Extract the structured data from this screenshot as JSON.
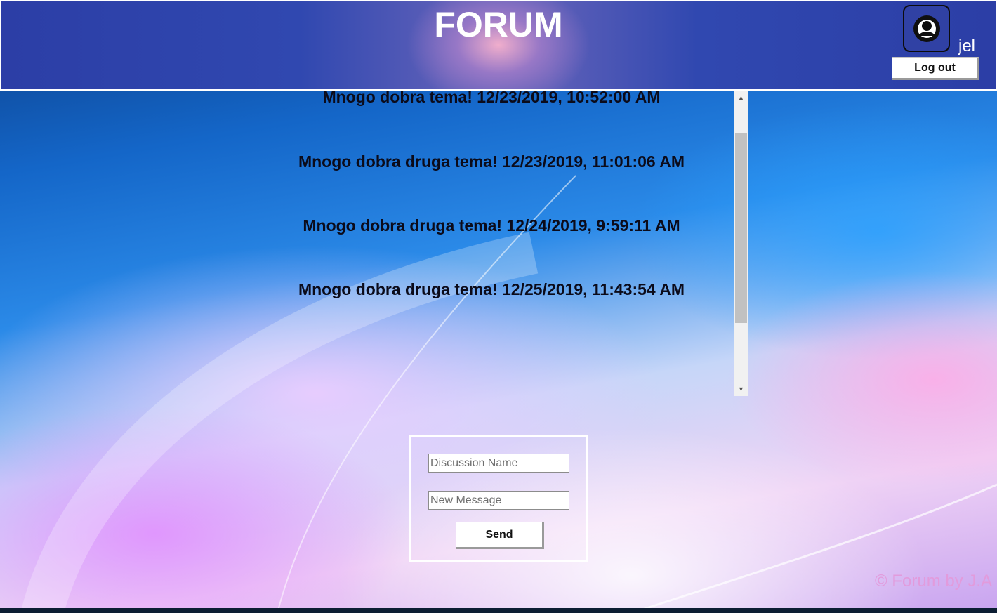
{
  "header": {
    "title": "FORUM",
    "username": "jel",
    "logout_label": "Log out",
    "avatar_icon": "user-circle-icon"
  },
  "messages": [
    {
      "text": "Mnogo dobra tema! 12/23/2019, 10:52:00 AM"
    },
    {
      "text": "Mnogo dobra druga tema! 12/23/2019, 11:01:06 AM"
    },
    {
      "text": "Mnogo dobra druga tema! 12/24/2019, 9:59:11 AM"
    },
    {
      "text": "Mnogo dobra druga tema! 12/25/2019, 11:43:54 AM"
    }
  ],
  "form": {
    "discussion_placeholder": "Discussion Name",
    "message_placeholder": "New Message",
    "send_label": "Send"
  },
  "footer": {
    "credit": "© Forum by J.A"
  },
  "colors": {
    "header_bg": "#2c3ea6",
    "footer_text": "#e29bdc"
  }
}
